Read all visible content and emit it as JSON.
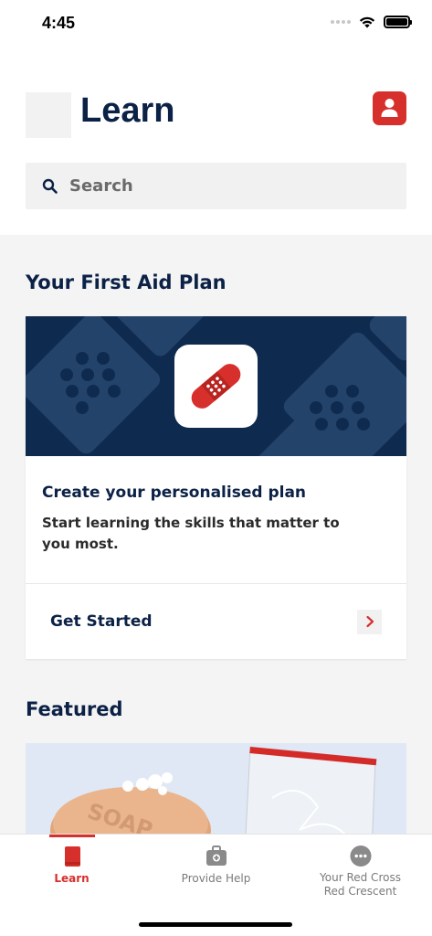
{
  "status": {
    "time": "4:45"
  },
  "header": {
    "title": "Learn"
  },
  "search": {
    "placeholder": "Search"
  },
  "plan": {
    "section_title": "Your First Aid Plan",
    "card_heading": "Create your personalised plan",
    "card_description": "Start learning the skills that matter to you most.",
    "action_label": "Get Started"
  },
  "featured": {
    "section_title": "Featured"
  },
  "tabs": [
    {
      "label": "Learn",
      "icon": "book-icon",
      "active": true
    },
    {
      "label": "Provide Help",
      "icon": "first-aid-kit-icon",
      "active": false
    },
    {
      "label": "Your Red Cross Red Crescent",
      "icon": "more-dots-icon",
      "active": false
    }
  ],
  "colors": {
    "brand_red": "#d7302c",
    "navy": "#0b2146",
    "banner_navy": "#0f2a4f"
  }
}
